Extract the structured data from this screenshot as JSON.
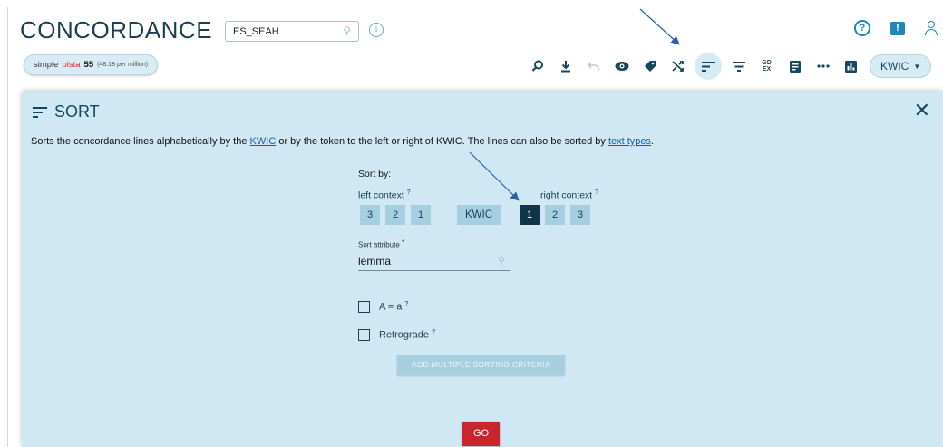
{
  "app": {
    "title": "CONCORDANCE"
  },
  "corpus": {
    "name": "ES_SEAH"
  },
  "query": {
    "type": "simple",
    "word": "pista",
    "count": "55",
    "ipm": "(48.18 per million)"
  },
  "toolbar": {
    "view_mode": "KWIC",
    "icons": [
      "search-icon",
      "download-icon",
      "undo-icon",
      "view-icon",
      "tag-icon",
      "shuffle-icon",
      "sort-icon",
      "filter-icon",
      "gdex-icon",
      "text-types-icon",
      "collocations-icon",
      "frequency-icon"
    ],
    "gdex_top": "GD",
    "gdex_bottom": "EX"
  },
  "panel": {
    "title": "SORT",
    "desc_start": "Sorts the concordance lines alphabetically by the ",
    "desc_link1": "KWIC",
    "desc_mid": " or by the token to the left or right of KWIC. The lines can also be sorted by ",
    "desc_link2": "text types",
    "desc_end": ".",
    "sort_by_label": "Sort by:",
    "left_context_label": "left context",
    "right_context_label": "right context",
    "help_mark": "?",
    "left_buttons": [
      "3",
      "2",
      "1"
    ],
    "kwic_button": "KWIC",
    "right_buttons": [
      "1",
      "2",
      "3"
    ],
    "right_selected": "1",
    "sort_attribute_label": "Sort attribute",
    "sort_attribute_value": "lemma",
    "checkbox_case": "A = a",
    "checkbox_retrograde": "Retrograde",
    "multi_button": "ADD MULTIPLE SORTING CRITERIA",
    "go_button": "GO"
  },
  "colors": {
    "accent": "#1c87b8",
    "panel_bg": "#cfe8f3",
    "go": "#c8252f",
    "selected": "#103549"
  }
}
